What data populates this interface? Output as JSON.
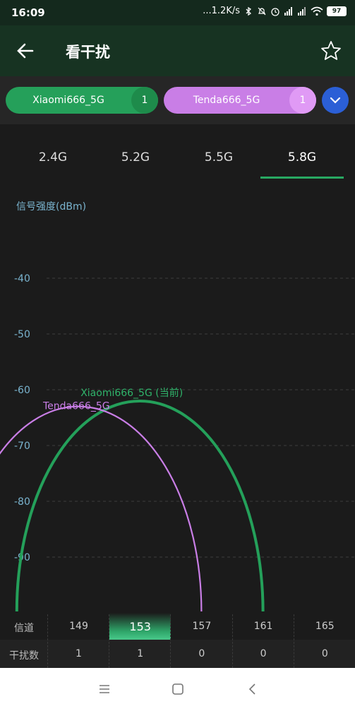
{
  "status": {
    "time": "16:09",
    "speed": "...1.2K/s",
    "battery": "97"
  },
  "appbar": {
    "title": "看干扰"
  },
  "chips": [
    {
      "name": "Xiaomi666_5G",
      "count": "1",
      "color": "#25a05a"
    },
    {
      "name": "Tenda666_5G",
      "count": "1",
      "color": "#c97ee6"
    }
  ],
  "tabs": [
    {
      "label": "2.4G",
      "active": false
    },
    {
      "label": "5.2G",
      "active": false
    },
    {
      "label": "5.5G",
      "active": false
    },
    {
      "label": "5.8G",
      "active": true
    }
  ],
  "chart_data": {
    "type": "area",
    "ylabel": "信号强度(dBm)",
    "yticks": [
      "-40",
      "-50",
      "-60",
      "-70",
      "-80",
      "-90"
    ],
    "ylim": [
      -100,
      -30
    ],
    "xlabel_row": "信道",
    "channels": [
      "149",
      "153",
      "157",
      "161",
      "165"
    ],
    "selected_channel": "153",
    "interference_label": "干扰数",
    "interference": [
      "1",
      "1",
      "0",
      "0",
      "0"
    ],
    "series": [
      {
        "name": "Xiaomi666_5G (当前)",
        "color": "#24a05a",
        "center_channel": 153,
        "width_mhz": 80,
        "peak_dbm": -62
      },
      {
        "name": "Tenda666_5G",
        "color": "#c97ee6",
        "center_channel": 149,
        "width_mhz": 80,
        "peak_dbm": -63
      }
    ]
  }
}
